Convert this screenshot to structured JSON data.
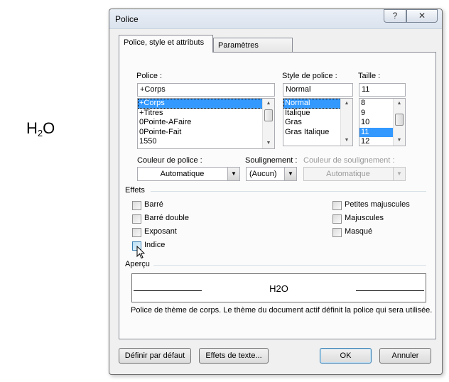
{
  "document": {
    "formula_main": "H",
    "formula_sub": "2",
    "formula_tail": "O"
  },
  "dialog": {
    "title": "Police",
    "help_label": "?",
    "close_label": "✕",
    "tabs": [
      {
        "label": "Police, style et attributs",
        "active": true
      },
      {
        "label": "Paramètres avancés",
        "active": false
      }
    ],
    "font": {
      "label": "Police :",
      "value": "+Corps",
      "items": [
        "+Corps",
        "+Titres",
        "0Pointe-AFaire",
        "0Pointe-Fait",
        "1550"
      ],
      "selected": "+Corps"
    },
    "style": {
      "label": "Style de police :",
      "value": "Normal",
      "items": [
        "Normal",
        "Italique",
        "Gras",
        "Gras Italique"
      ],
      "selected": "Normal"
    },
    "size": {
      "label": "Taille :",
      "value": "11",
      "items": [
        "8",
        "9",
        "10",
        "11",
        "12"
      ],
      "selected": "11"
    },
    "font_color": {
      "label": "Couleur de police :",
      "value": "Automatique"
    },
    "underline": {
      "label": "Soulignement :",
      "value": "(Aucun)"
    },
    "underline_color": {
      "label": "Couleur de soulignement :",
      "value": "Automatique",
      "disabled": true
    },
    "effects": {
      "label": "Effets",
      "left": [
        {
          "label": "Barré",
          "checked": false
        },
        {
          "label": "Barré double",
          "checked": false
        },
        {
          "label": "Exposant",
          "checked": false
        },
        {
          "label": "Indice",
          "checked": false,
          "hovered": true
        }
      ],
      "right": [
        {
          "label": "Petites majuscules",
          "checked": false
        },
        {
          "label": "Majuscules",
          "checked": false
        },
        {
          "label": "Masqué",
          "checked": false
        }
      ]
    },
    "preview": {
      "label": "Aperçu",
      "sample": "H2O",
      "description": "Police de thème de corps. Le thème du document actif définit la police qui sera utilisée."
    },
    "buttons": {
      "set_default": "Définir par défaut",
      "text_effects": "Effets de texte...",
      "ok": "OK",
      "cancel": "Annuler"
    }
  },
  "colors": {
    "selection": "#3399ff",
    "default_button_border": "#3c7fb1"
  }
}
